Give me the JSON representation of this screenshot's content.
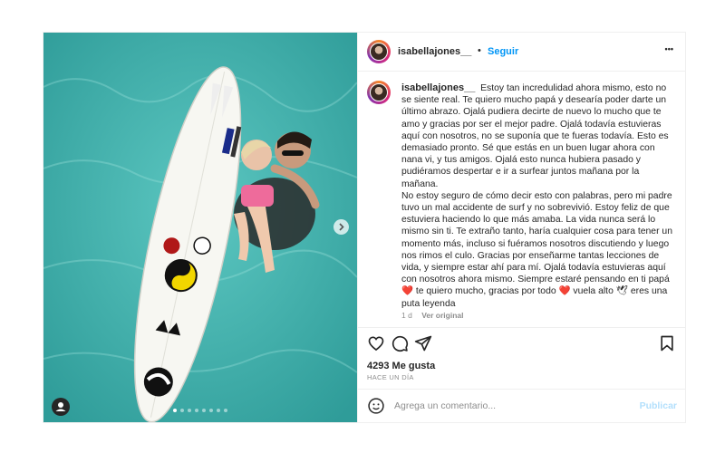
{
  "post": {
    "username": "isabellajones__",
    "separator": "•",
    "follow_label": "Seguir",
    "more_label": "•••",
    "caption_paragraphs": [
      "Estoy tan incredulidad ahora mismo, esto no se siente real. Te quiero mucho papá y desearía poder darte un último abrazo. Ojalá pudiera decirte de nuevo lo mucho que te amo y gracias por ser el mejor padre. Ojalá todavía estuvieras aquí con nosotros, no se suponía que te fueras todavía. Esto es demasiado pronto. Sé que estás en un buen lugar ahora con nana vi, y tus amigos. Ojalá esto nunca hubiera pasado y pudiéramos despertar e ir a surfear juntos mañana por la mañana.",
      "No estoy seguro de cómo decir esto con palabras, pero mi padre tuvo un mal accidente de surf y no sobrevivió. Estoy feliz de que estuviera haciendo lo que más amaba. La vida nunca será lo mismo sin ti. Te extraño tanto, haría cualquier cosa para tener un momento más, incluso si fuéramos nosotros discutiendo y luego nos rimos el culo. Gracias por enseñarme tantas lecciones de vida, y siempre estar ahí para mí. Ojalá todavía estuvieras aquí con nosotros ahora mismo. Siempre estaré pensando en ti papá"
    ],
    "caption_tail": [
      " te quiero mucho, gracias por todo ",
      " vuela alto ",
      " eres una puta leyenda"
    ],
    "time_ago": "1 d",
    "see_original": "Ver original",
    "likes": "4293 Me gusta",
    "posted_ago": "HACE UN DÍA",
    "comment_placeholder": "Agrega un comentario...",
    "publish_label": "Publicar"
  },
  "colors": {
    "accent": "#0095f6",
    "heart": "#ed4956",
    "water": "#3fb0ad"
  },
  "icons": [
    "user-tag-icon",
    "chevron-right-icon",
    "heart-icon",
    "comment-icon",
    "share-icon",
    "bookmark-icon",
    "emoji-icon"
  ],
  "carousel": {
    "slide_count": 8,
    "active_index": 0
  }
}
